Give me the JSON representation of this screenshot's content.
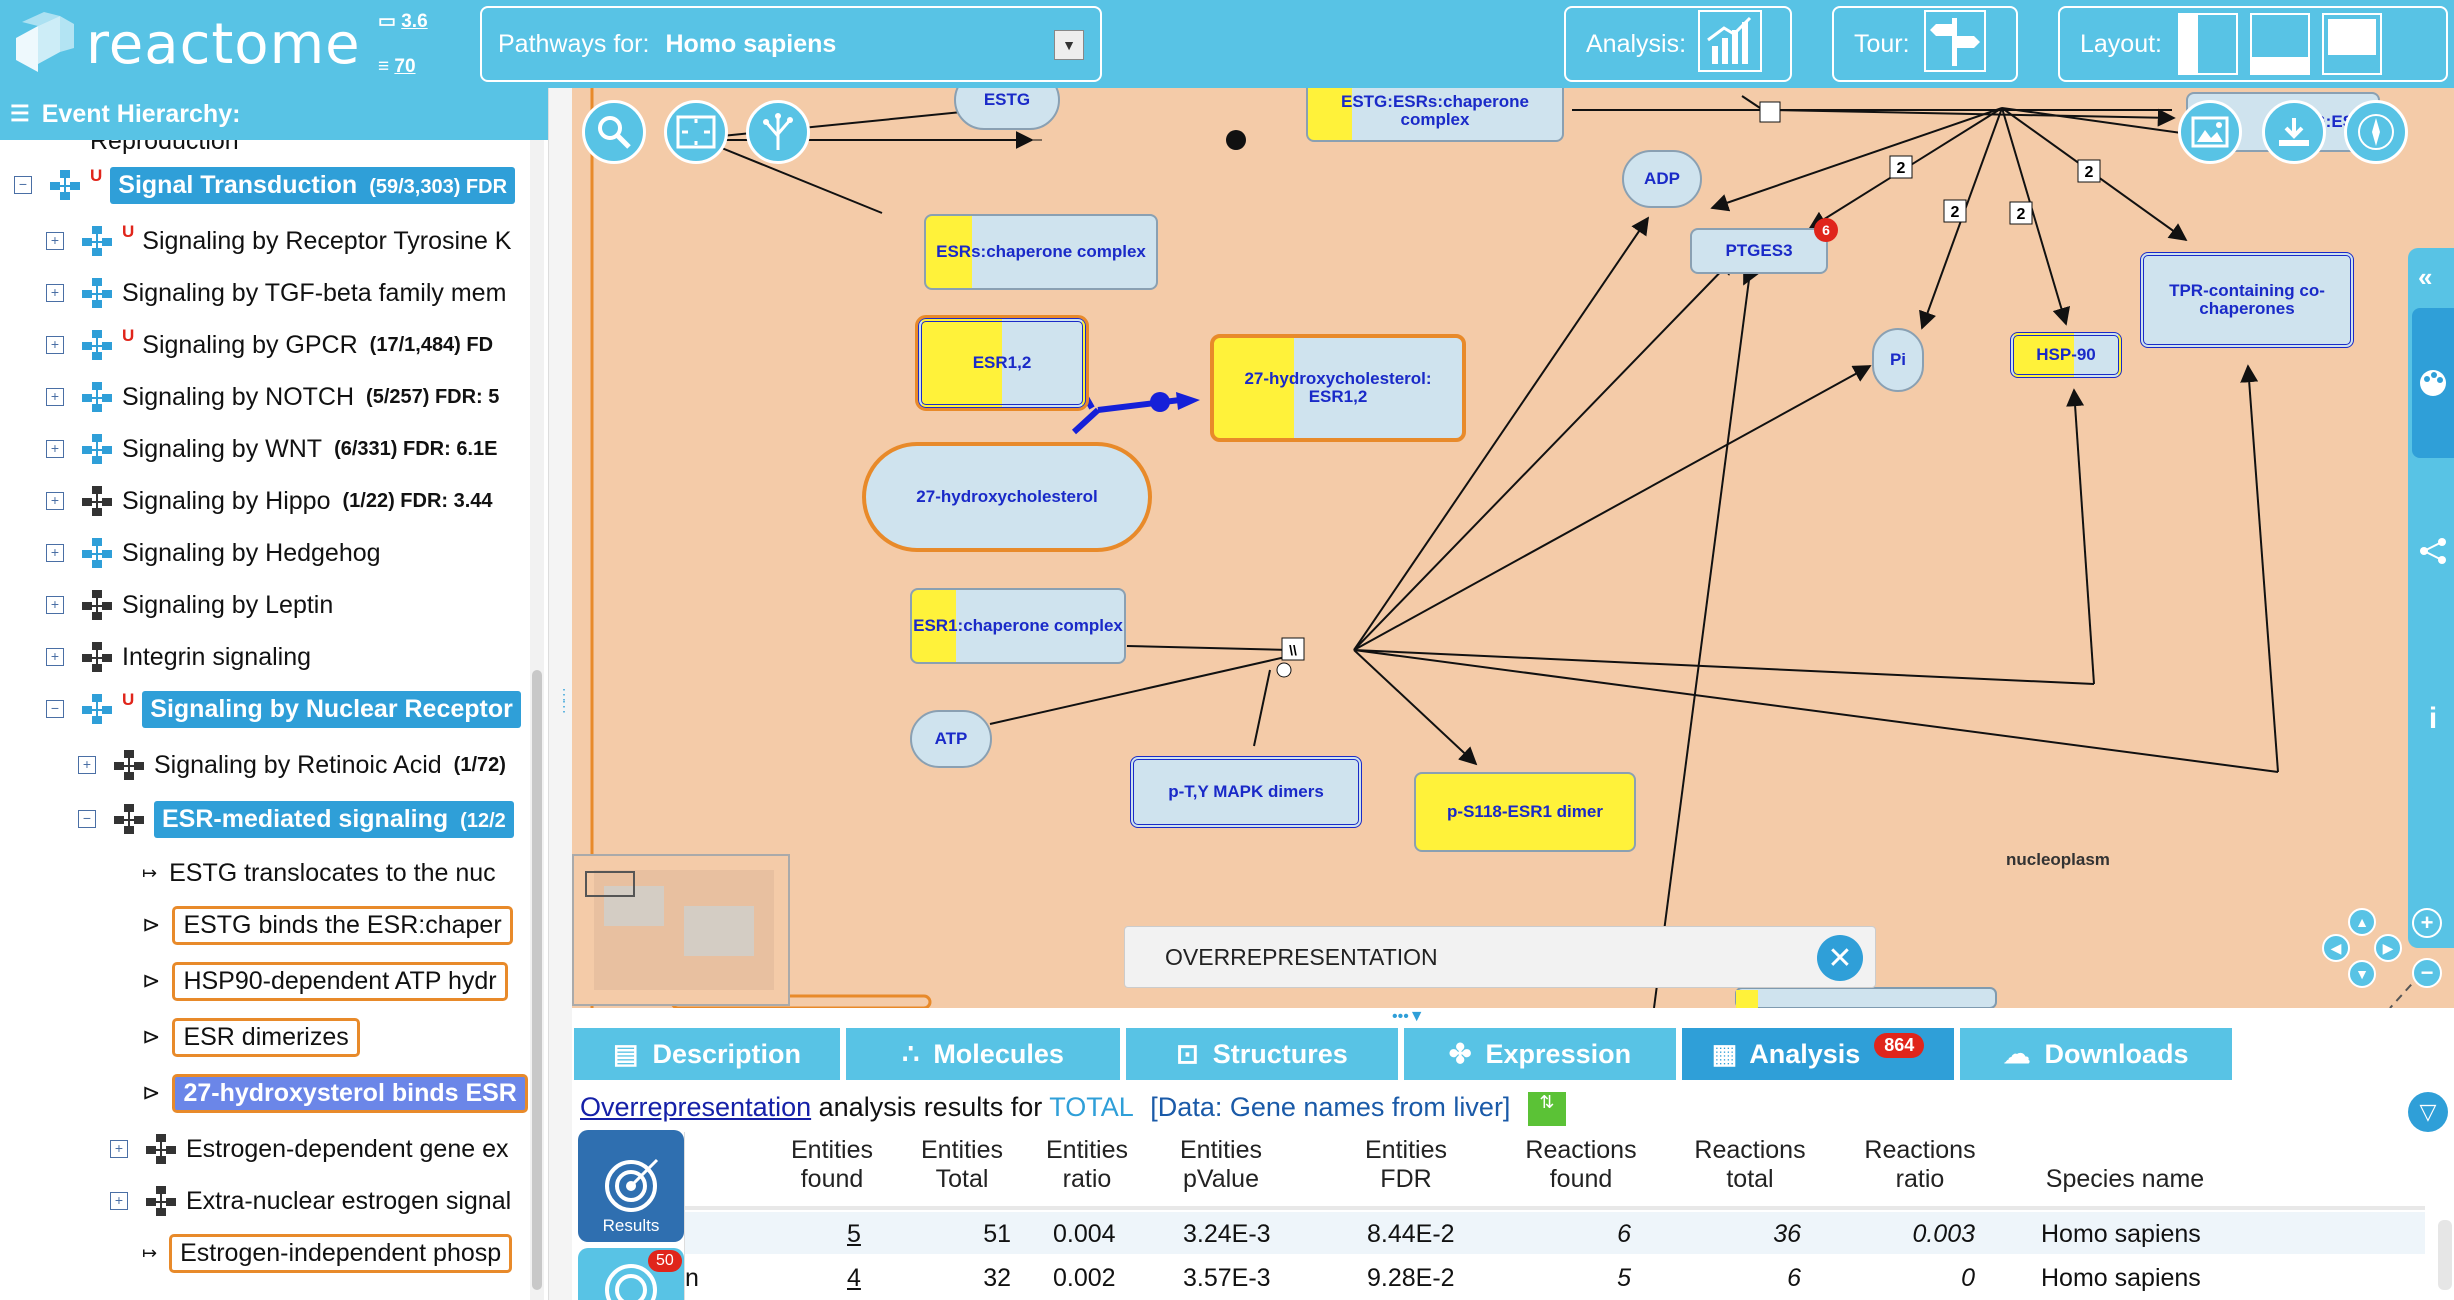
{
  "header": {
    "logo_text": "reactome",
    "version": "3.6",
    "release": "70",
    "species_label": "Pathways for:",
    "species_value": "Homo sapiens",
    "analysis_label": "Analysis:",
    "tour_label": "Tour:",
    "layout_label": "Layout:"
  },
  "hierarchy": {
    "title": "Event Hierarchy:",
    "top_cut": "Reproduction",
    "items": [
      {
        "label": "Signal Transduction",
        "count": "(59/3,303) FDR"
      },
      {
        "label": "Signaling by Receptor Tyrosine K"
      },
      {
        "label": "Signaling by TGF-beta family mem"
      },
      {
        "label": "Signaling by GPCR",
        "count": "(17/1,484) FD"
      },
      {
        "label": "Signaling by NOTCH",
        "count": "(5/257) FDR: 5"
      },
      {
        "label": "Signaling by WNT",
        "count": "(6/331) FDR: 6.1E"
      },
      {
        "label": "Signaling by Hippo",
        "count": "(1/22) FDR: 3.44"
      },
      {
        "label": "Signaling by Hedgehog"
      },
      {
        "label": "Signaling by Leptin"
      },
      {
        "label": "Integrin signaling"
      },
      {
        "label": "Signaling by Nuclear Receptor"
      },
      {
        "label": "Signaling by Retinoic Acid",
        "count": "(1/72)"
      },
      {
        "label": "ESR-mediated signaling",
        "count": "(12/2"
      },
      {
        "label": "ESTG translocates to the nuc"
      },
      {
        "label": "ESTG binds the ESR:chaper"
      },
      {
        "label": "HSP90-dependent ATP hydr"
      },
      {
        "label": "ESR dimerizes"
      },
      {
        "label": "27-hydroxysterol binds ESR"
      },
      {
        "label": "Estrogen-dependent gene ex"
      },
      {
        "label": "Extra-nuclear estrogen signal"
      },
      {
        "label": "Estrogen-independent phosp"
      }
    ]
  },
  "diagram": {
    "nodes": {
      "estg": "ESTG",
      "estg_esrs": "ESTG:ESRs:chaperone complex",
      "adp": "ADP",
      "ptges3": "PTGES3",
      "ptges3_badge": "6",
      "esrs_chap": "ESRs:chaperone complex",
      "esr12": "ESR1,2",
      "hc_esr": "27-hydroxycholesterol: ESR1,2",
      "hc": "27-hydroxycholesterol",
      "pi": "Pi",
      "hsp90": "HSP-90",
      "tpr": "TPR-containing co-chaperones",
      "esr1_chap": "ESR1:chaperone complex",
      "atp": "ATP",
      "mapk": "p-T,Y MAPK dimers",
      "ps118": "p-S118-ESR1 dimer",
      "nucleoplasm": "nucleoplasm",
      "top_right": "ESTG:ES",
      "stoich": "2",
      "reaction_mark": "\\\\"
    },
    "overlay_label": "OVERREPRESENTATION"
  },
  "tabs": [
    {
      "label": "Description"
    },
    {
      "label": "Molecules"
    },
    {
      "label": "Structures"
    },
    {
      "label": "Expression"
    },
    {
      "label": "Analysis",
      "badge": "864"
    },
    {
      "label": "Downloads"
    }
  ],
  "analysis": {
    "link": "Overrepresentation",
    "text_mid": "analysis results for",
    "total": "TOTAL",
    "data": "[Data: Gene names from liver]",
    "results_label": "Results",
    "results2_badge": "50",
    "columns": [
      "Entities found",
      "Entities Total",
      "Entities ratio",
      "Entities pValue",
      "Entities FDR",
      "Reactions found",
      "Reactions total",
      "Reactions ratio",
      "Species name"
    ],
    "rows": [
      {
        "name": "",
        "found": "5",
        "total": "51",
        "ratio": "0.004",
        "pvalue": "3.24E-3",
        "fdr": "8.44E-2",
        "r_found": "6",
        "r_total": "36",
        "r_ratio": "0.003",
        "species": "Homo sapiens"
      },
      {
        "name": "n",
        "found": "4",
        "total": "32",
        "ratio": "0.002",
        "pvalue": "3.57E-3",
        "fdr": "9.28E-2",
        "r_found": "5",
        "r_total": "6",
        "r_ratio": "0",
        "species": "Homo sapiens"
      }
    ]
  },
  "colors": {
    "brand": "#58c3e5",
    "selected": "#2f9fd8",
    "diagram_bg": "#f4cba8",
    "entity": "#cfe3ee",
    "highlight": "#fff23a",
    "badge": "#e0251b"
  }
}
